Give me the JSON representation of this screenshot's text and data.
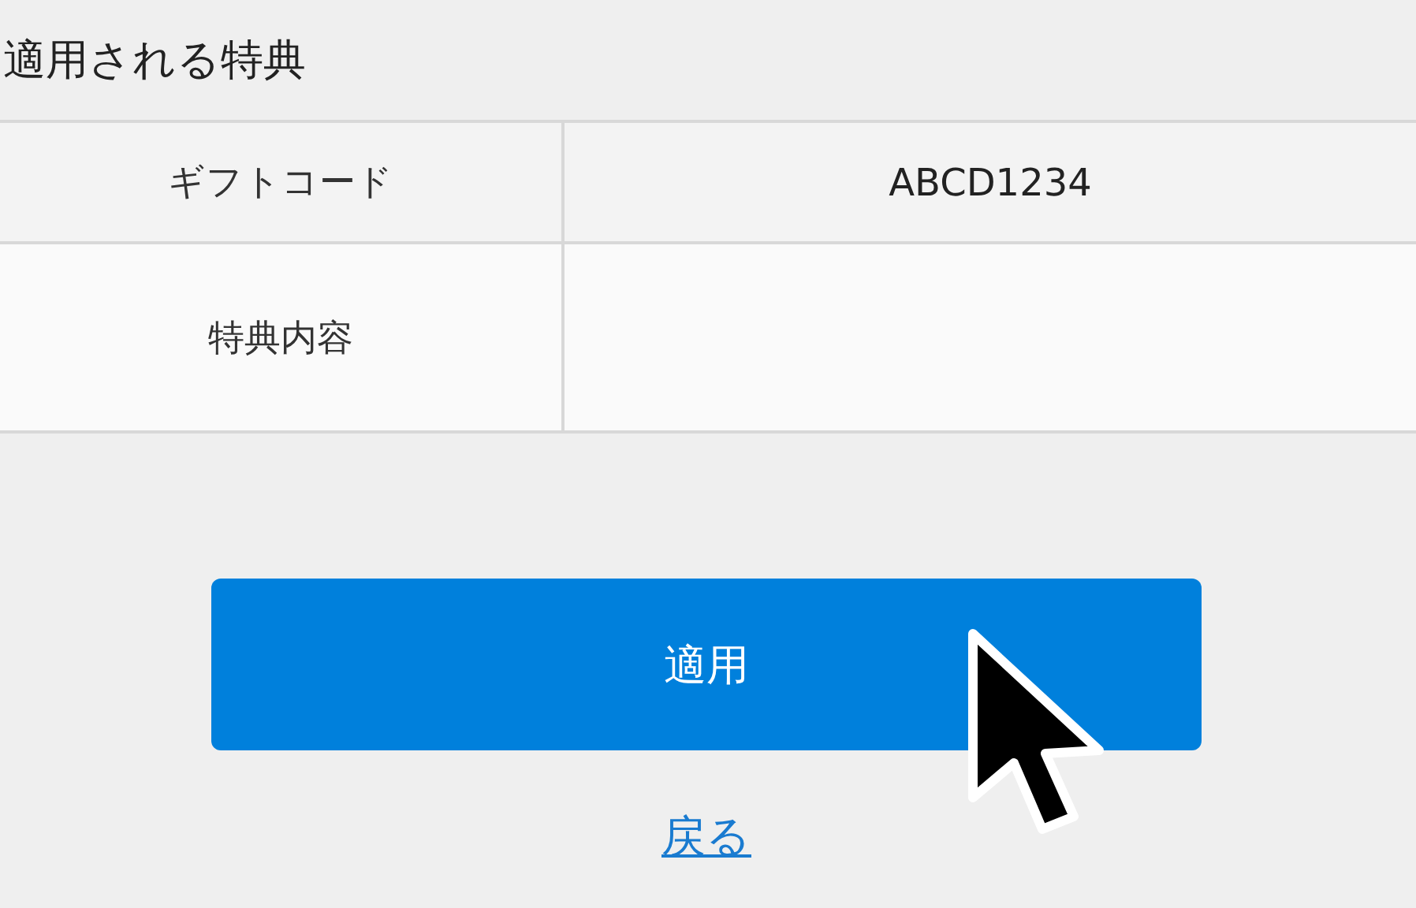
{
  "heading": "適用される特典",
  "rows": [
    {
      "label": "ギフトコード",
      "value": "ABCD1234"
    },
    {
      "label": "特典内容"
    }
  ],
  "apply_button": "適用",
  "back_link": "戻る"
}
